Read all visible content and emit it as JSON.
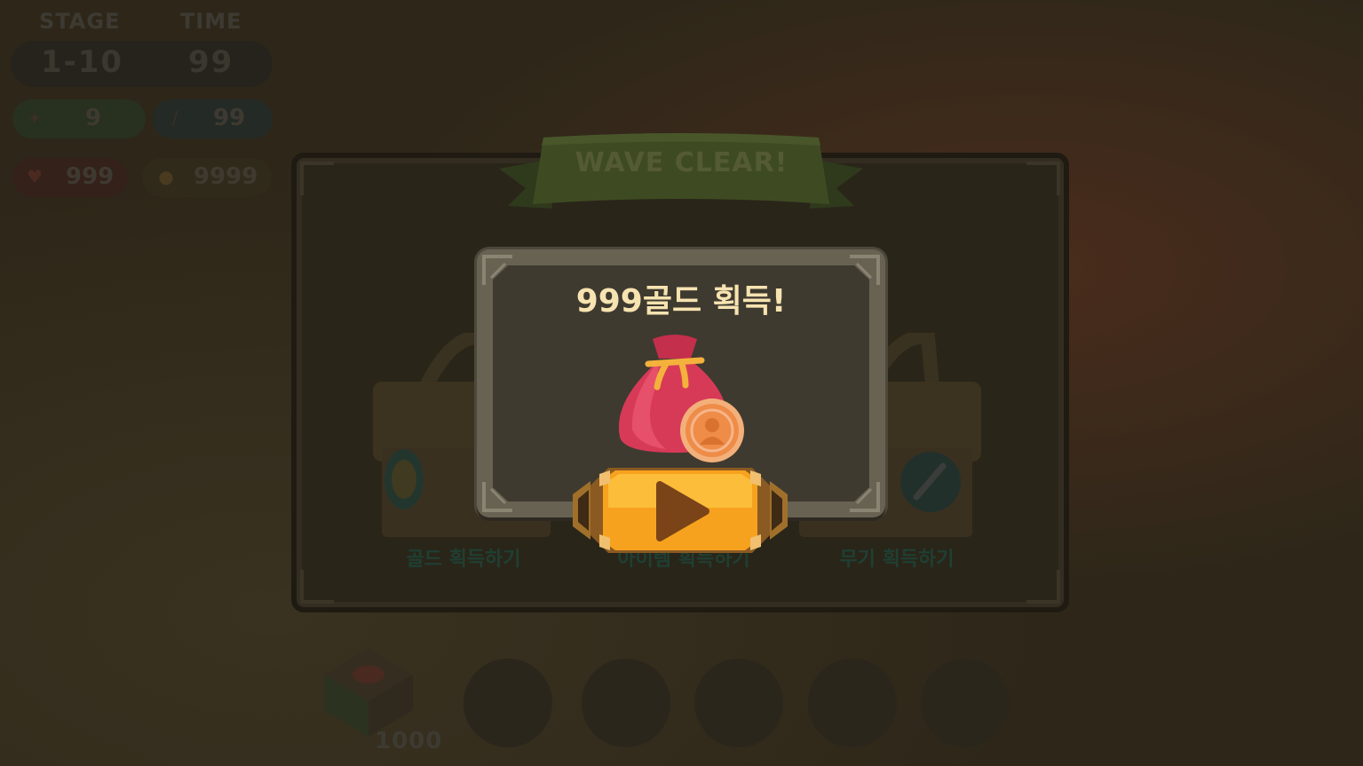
{
  "hud": {
    "stage_label": "STAGE",
    "time_label": "TIME",
    "stage_value": "1-10",
    "time_value": "99",
    "stat1_value": "9",
    "stat2_value": "99",
    "stat3_value": "999",
    "stat4_value": "9999"
  },
  "banner": {
    "title": "WAVE CLEAR!"
  },
  "rewards": {
    "left_label": "골드 획득하기",
    "center_label": "아이템 획득하기",
    "right_label": "무기 획득하기"
  },
  "bottom": {
    "count": "1000"
  },
  "popup": {
    "title": "999골드 획득!"
  },
  "colors": {
    "popup_title": "#f6e3b0",
    "play_button": "#f7a21e",
    "bag": "#d23a55",
    "coin": "#f2904a"
  },
  "icons": {
    "play": "play-icon",
    "bag": "money-bag-icon",
    "coin": "coin-icon"
  }
}
